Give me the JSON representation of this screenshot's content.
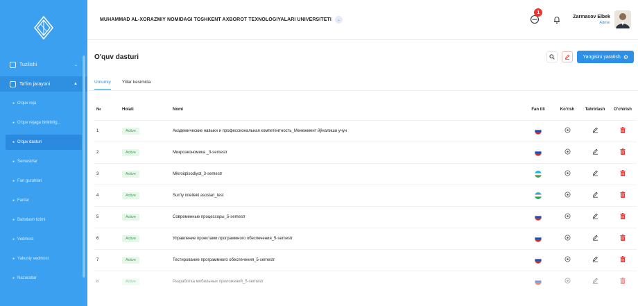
{
  "header": {
    "university": "MUHAMMAD AL-XORAZMIY NOMIDAGI TOSHKENT AXBOROT TEXNOLOGIYALARI UNIVERSITETI",
    "notification_count": "1",
    "user_name": "Zarmasov Elbek",
    "user_role": "Admin"
  },
  "sidebar": {
    "groups": [
      {
        "label": "Tuzilishi"
      },
      {
        "label": "Ta'lim jarayoni"
      }
    ],
    "items": [
      {
        "label": "O'quv reja"
      },
      {
        "label": "O'quv rejaga biriktirilg..."
      },
      {
        "label": "O'quv dasturi"
      },
      {
        "label": "Semestrlar"
      },
      {
        "label": "Fan guruhlari"
      },
      {
        "label": "Fanlar"
      },
      {
        "label": "Baholash tizimi"
      },
      {
        "label": "Vedmost"
      },
      {
        "label": "Yakuniy vedmost"
      },
      {
        "label": "Nazoratlar"
      }
    ]
  },
  "page": {
    "title": "O'quv dasturi",
    "create_label": "Yangisini yaratish",
    "tabs": [
      {
        "label": "Umumiy"
      },
      {
        "label": "Yillar kesimida"
      }
    ]
  },
  "table": {
    "headers": {
      "no": "№",
      "status": "Holati",
      "name": "Nomi",
      "lang": "Fan tili",
      "view": "Ko'rish",
      "edit": "Tahrirlash",
      "delete": "O'chirish"
    },
    "rows": [
      {
        "no": "1",
        "status": "Active",
        "name": "Академические навыки и профессиональная компетентность_Менежмент йўналиши учун",
        "lang": "ru"
      },
      {
        "no": "2",
        "status": "Active",
        "name": "Микроэкономика _3-semestr",
        "lang": "ru"
      },
      {
        "no": "3",
        "status": "Active",
        "name": "Mikroiqtisodiyot_3-semestr",
        "lang": "uz"
      },
      {
        "no": "4",
        "status": "Active",
        "name": "Sun'iy intellekt asoslari_test",
        "lang": "uz"
      },
      {
        "no": "5",
        "status": "Active",
        "name": "Современные процессоры_5-semestr",
        "lang": "ru"
      },
      {
        "no": "6",
        "status": "Active",
        "name": "Управление проектами программного обеспечения_5-semestr",
        "lang": "ru"
      },
      {
        "no": "7",
        "status": "Active",
        "name": "Тестирование программного обеспечения_5-semestr",
        "lang": "ru"
      },
      {
        "no": "8",
        "status": "Active",
        "name": "Разработка мобильных приложений_5-semestr",
        "lang": "ru"
      }
    ]
  },
  "colors": {
    "sidebar": "#3aa0ef",
    "accent": "#2e8fe6",
    "active_badge_text": "#2ea44f",
    "delete_icon": "#e53935"
  }
}
